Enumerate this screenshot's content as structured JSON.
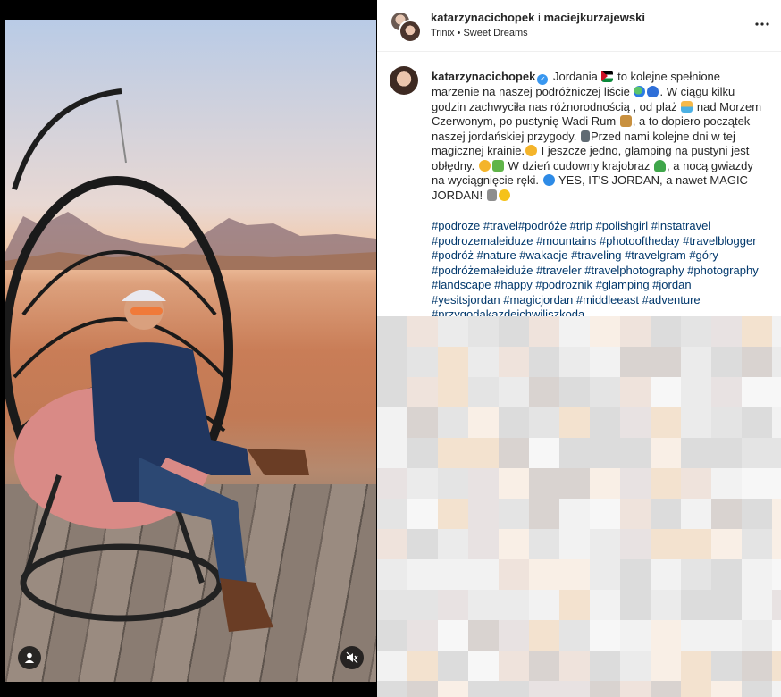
{
  "post": {
    "authors": {
      "first": "katarzynacichopek",
      "separator": "i",
      "second": "maciejkurzajewski"
    },
    "audio": {
      "artist": "Trinix",
      "dot": "•",
      "track": "Sweet Dreams"
    },
    "more_icon": "more-horizontal-icon"
  },
  "caption": {
    "username": "katarzynacichopek",
    "verified_icon": "verified-badge-icon",
    "t1": "Jordania",
    "t2": "to kolejne spełnione marzenie na naszej podróżniczej liście",
    "t3": ". W ciągu kilku godzin zachwyciła nas różnorodnością , od plaż",
    "t4": "nad Morzem Czerwonym, po pustynię Wadi Rum",
    "t5": ", a to dopiero początek naszej jordańskiej przygody.",
    "t6": "Przed nami kolejne dni w tej magicznej krainie.",
    "t7": "I jeszcze jedno, glamping na pustyni jest obłędny.",
    "t8": "W dzień cudowny krajobraz",
    "t9": ", a nocą gwiazdy na wyciągnięcie ręki.",
    "t10": "YES, IT'S JORDAN, a nawet MAGIC JORDAN!",
    "hashtags": "#podroze #travel#podróże #trip #polishgirl #instatravel #podrozemaleiduze #mountains #photooftheday #travelblogger #podróż #nature #wakacje #traveling #travelgram #góry #podróżemałeiduże #traveler #travelphotography #photography #landscape #happy #podroznik #glamping #jordan #yesitsjordan #magicjordan #middleeast #adventure #przygodakazdejchwiliszkoda"
  },
  "media": {
    "user_tag_icon": "user-tag-icon",
    "mute_icon": "speaker-muted-icon"
  },
  "colors": {
    "hashtag": "#00376b",
    "verified": "#3897f0",
    "text": "#262626"
  }
}
